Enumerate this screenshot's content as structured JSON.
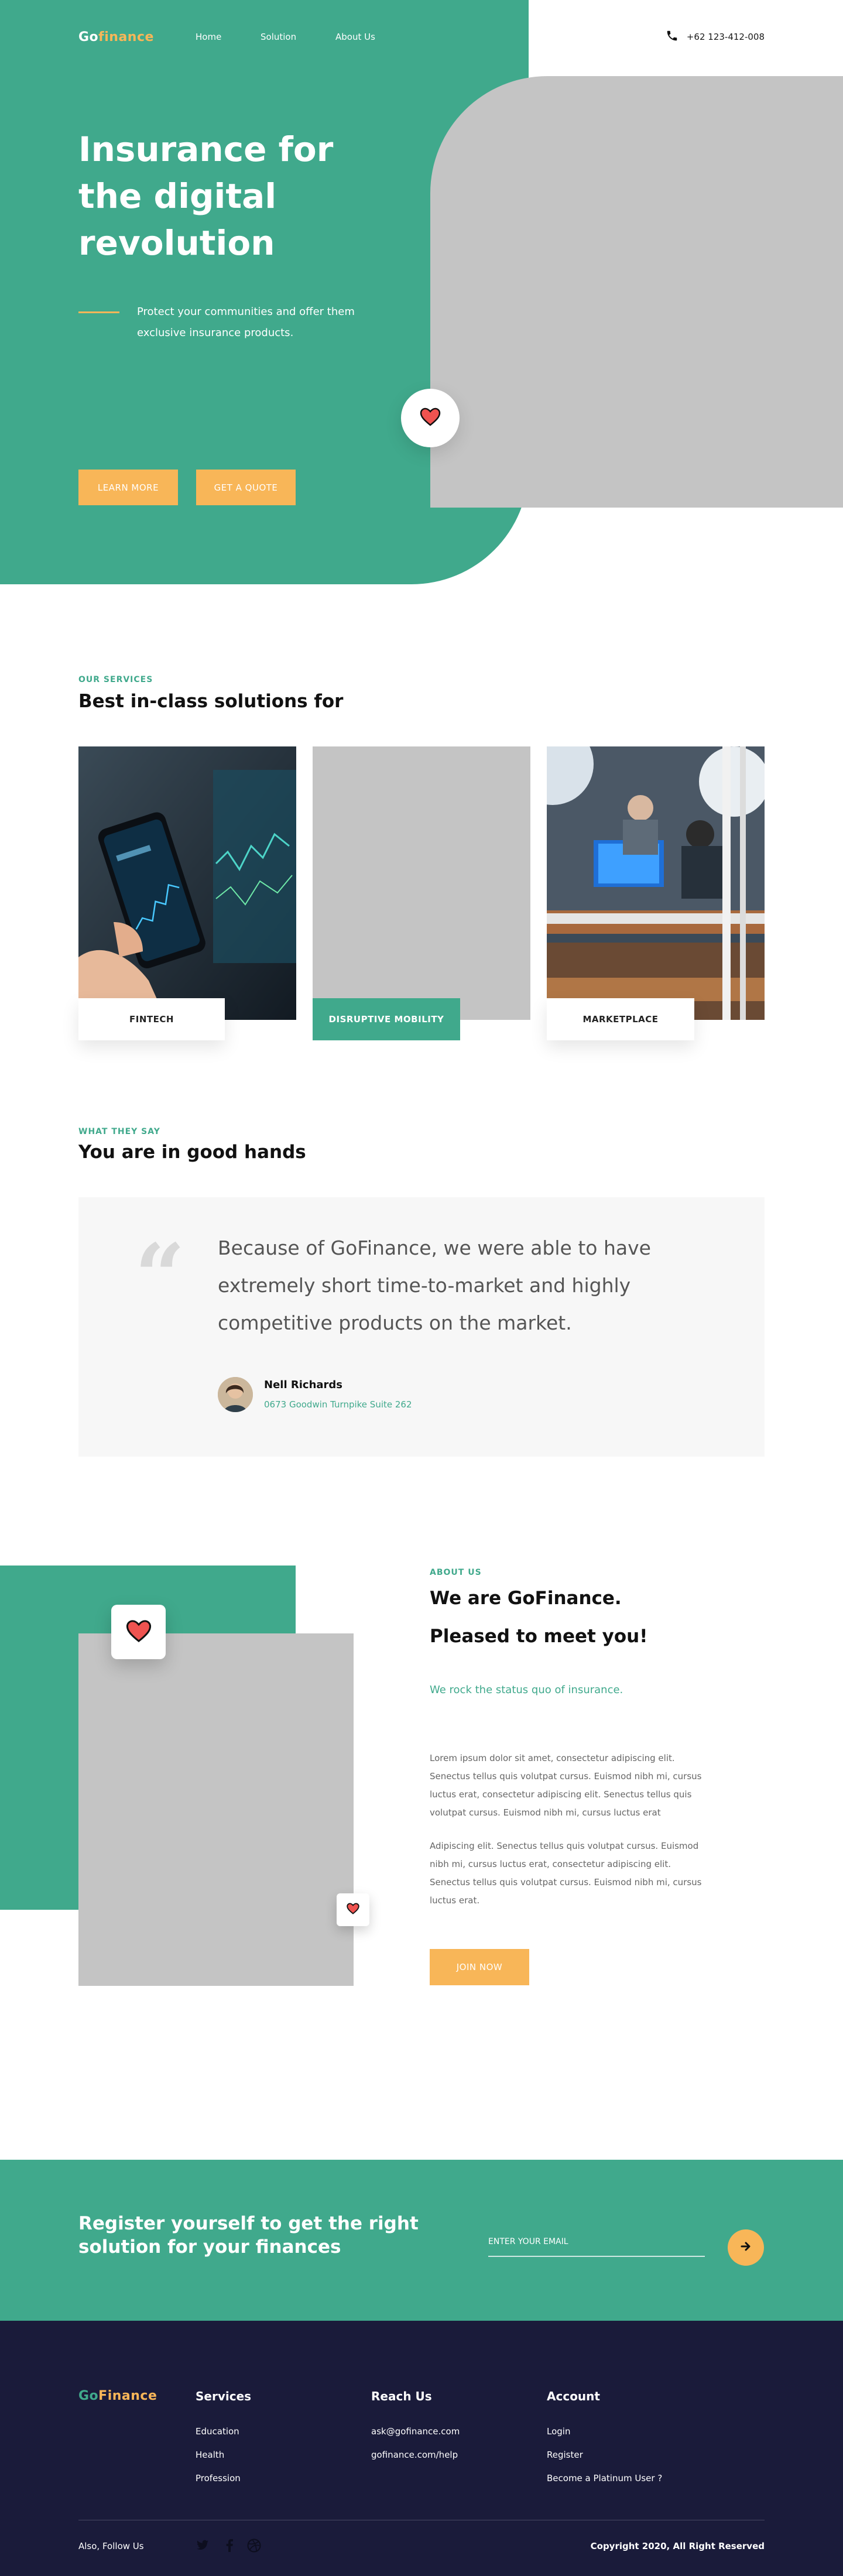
{
  "nav": {
    "logo_prefix": "Go",
    "logo_accent": "finance",
    "links": [
      "Home",
      "Solution",
      "About Us"
    ],
    "phone": "+62 123-412-008"
  },
  "hero": {
    "title": "Insurance for the digital revolution",
    "description": "Protect your communities and offer them exclusive insurance products.",
    "btn_learn": "LEARN MORE",
    "btn_quote": "GET A QUOTE"
  },
  "services": {
    "eyebrow": "OUR SERVICES",
    "title": "Best in-class solutions for",
    "cards": [
      {
        "label": "FINTECH"
      },
      {
        "label": "DISRUPTIVE MOBILITY"
      },
      {
        "label": "MARKETPLACE"
      }
    ]
  },
  "testimonial": {
    "eyebrow": "WHAT THEY SAY",
    "title": "You are in good hands",
    "quote_mark": "“",
    "text": "Because of GoFinance, we were able to have extremely short time-to-market and highly competitive products on the market.",
    "name": "Nell Richards",
    "address": "0673 Goodwin Turnpike Suite 262"
  },
  "about": {
    "eyebrow": "ABOUT US",
    "title_line1": "We are GoFinance.",
    "title_line2": "Pleased to meet you!",
    "tagline": "We rock the status quo of insurance.",
    "paragraph1": "Lorem ipsum dolor sit amet, consectetur adipiscing elit. Senectus tellus quis volutpat cursus. Euismod nibh mi, cursus luctus erat, consectetur adipiscing elit. Senectus tellus quis volutpat cursus. Euismod nibh mi, cursus luctus erat",
    "paragraph2": "Adipiscing elit. Senectus tellus quis volutpat cursus. Euismod nibh mi, cursus luctus erat, consectetur adipiscing elit. Senectus tellus quis volutpat cursus. Euismod nibh mi, cursus luctus erat.",
    "btn_join": "JOIN NOW"
  },
  "register": {
    "title": "Register yourself to get the right solution for your finances",
    "email_placeholder": "ENTER YOUR EMAIL"
  },
  "footer": {
    "logo_prefix": "Go",
    "logo_accent": "Finance",
    "columns": [
      {
        "heading": "Services",
        "links": [
          "Education",
          "Health",
          "Profession"
        ]
      },
      {
        "heading": "Reach Us",
        "links": [
          "ask@gofinance.com",
          "gofinance.com/help"
        ]
      },
      {
        "heading": "Account",
        "links": [
          "Login",
          "Register",
          "Become a Platinum User ?"
        ]
      }
    ],
    "follow_label": "Also, Follow Us",
    "social_icons": [
      "twitter-icon",
      "facebook-icon",
      "dribbble-icon"
    ],
    "copyright": "Copyright 2020, All Right Reserved"
  },
  "colors": {
    "primary": "#40a98c",
    "accent": "#f8b658",
    "footer_bg": "#1a1b3a",
    "placeholder_gray": "#c4c4c4"
  }
}
